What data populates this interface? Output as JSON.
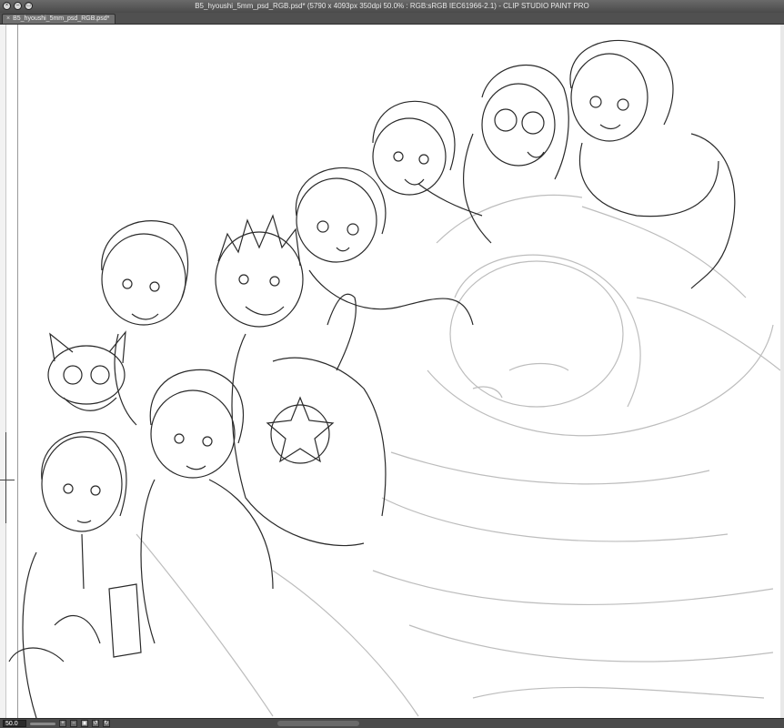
{
  "window": {
    "title": "B5_hyoushi_5mm_psd_RGB.psd* (5790 x 4093px 350dpi 50.0% : RGB:sRGB IEC61966-2.1) - CLIP STUDIO PAINT PRO"
  },
  "tab": {
    "label": "B5_hyoushi_5mm_psd_RGB.psd*"
  },
  "status": {
    "zoom": "50.0"
  },
  "colors": {
    "line": "#2a2a2a",
    "sketch": "#bdbdbd"
  }
}
